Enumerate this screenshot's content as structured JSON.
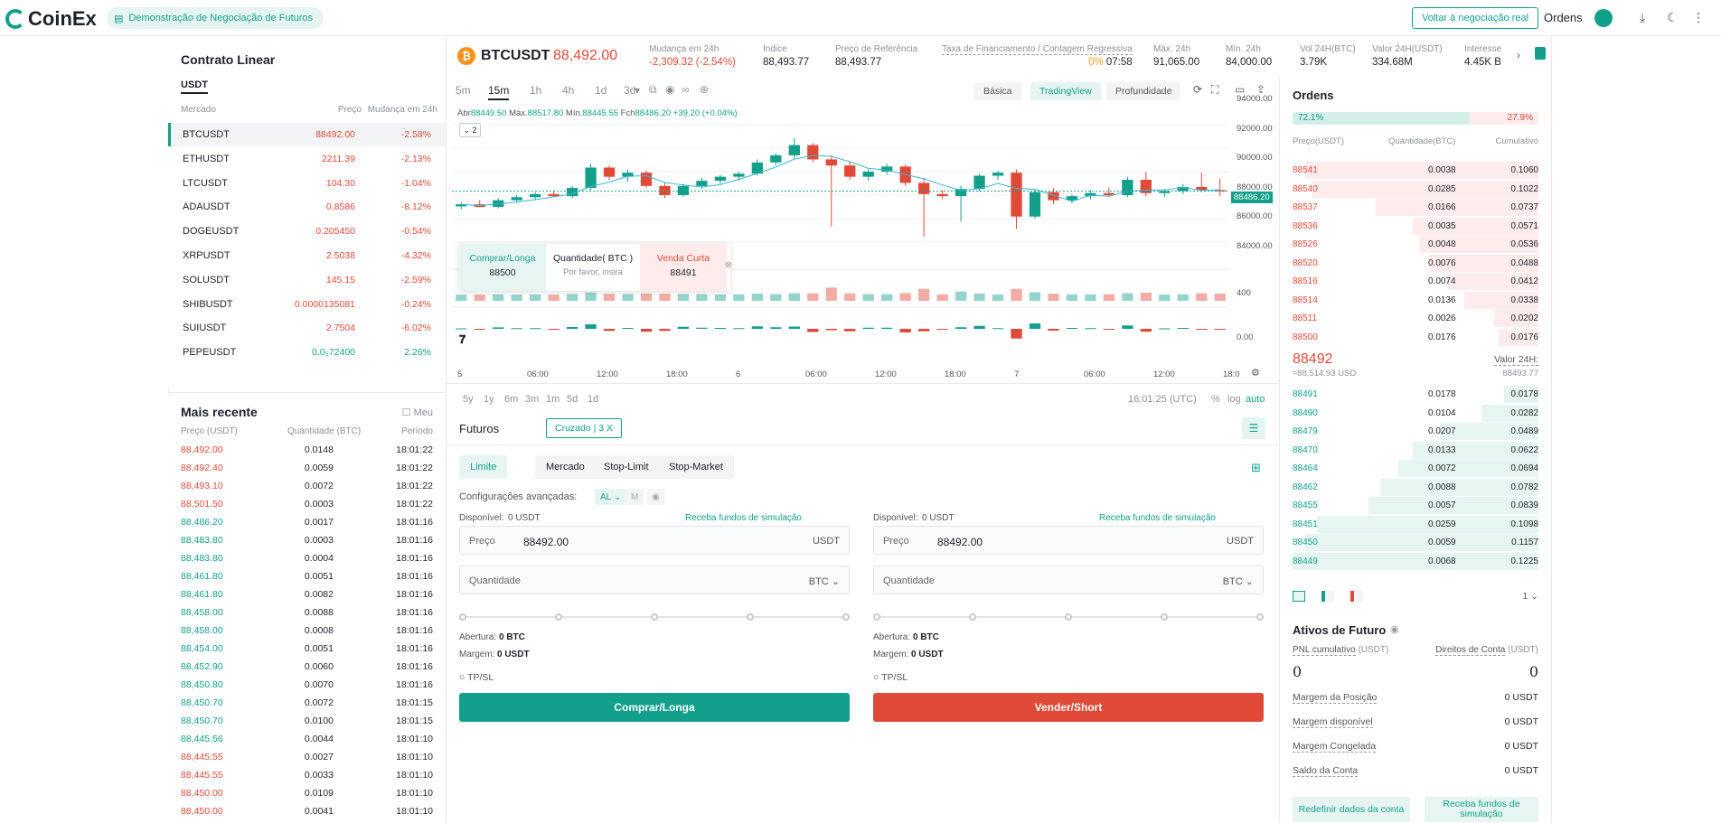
{
  "header": {
    "logo": "CoinEx",
    "demo_label": "Demonstração de Negociação de Futuros",
    "back_button": "Voltar à negociação real",
    "orders_link": "Ordens"
  },
  "markets": {
    "title": "Contrato Linear",
    "tab": "USDT",
    "col_market": "Mercado",
    "col_price": "Preço",
    "col_change": "Mudança em 24h",
    "rows": [
      {
        "symbol": "BTCUSDT",
        "price": "88492.00",
        "change": "-2.58%",
        "dir": "dn"
      },
      {
        "symbol": "ETHUSDT",
        "price": "2211.39",
        "change": "-2.13%",
        "dir": "dn"
      },
      {
        "symbol": "LTCUSDT",
        "price": "104.30",
        "change": "-1.04%",
        "dir": "dn"
      },
      {
        "symbol": "ADAUSDT",
        "price": "0.8586",
        "change": "-8.12%",
        "dir": "dn"
      },
      {
        "symbol": "DOGEUSDT",
        "price": "0.205450",
        "change": "-0.54%",
        "dir": "dn"
      },
      {
        "symbol": "XRPUSDT",
        "price": "2.5038",
        "change": "-4.32%",
        "dir": "dn"
      },
      {
        "symbol": "SOLUSDT",
        "price": "145.15",
        "change": "-2.59%",
        "dir": "dn"
      },
      {
        "symbol": "SHIBUSDT",
        "price": "0.0000135081",
        "change": "-0.24%",
        "dir": "dn"
      },
      {
        "symbol": "SUIUSDT",
        "price": "2.7504",
        "change": "-6.02%",
        "dir": "dn"
      },
      {
        "symbol": "PEPEUSDT",
        "price": "0.0₅72400",
        "change": "2.26%",
        "dir": "up"
      }
    ]
  },
  "trades": {
    "title": "Mais recente",
    "mine_label": "Meu",
    "col_price": "Preço (USDT)",
    "col_qty": "Quantidade (BTC)",
    "col_time": "Período",
    "rows": [
      {
        "p": "88,492.00",
        "q": "0.0148",
        "t": "18:01:22",
        "dir": "dn"
      },
      {
        "p": "88,492.40",
        "q": "0.0059",
        "t": "18:01:22",
        "dir": "dn"
      },
      {
        "p": "88,493.10",
        "q": "0.0072",
        "t": "18:01:22",
        "dir": "dn"
      },
      {
        "p": "88,501.50",
        "q": "0.0003",
        "t": "18:01:22",
        "dir": "dn"
      },
      {
        "p": "88,486.20",
        "q": "0.0017",
        "t": "18:01:16",
        "dir": "up"
      },
      {
        "p": "88,483.80",
        "q": "0.0003",
        "t": "18:01:16",
        "dir": "up"
      },
      {
        "p": "88,483.80",
        "q": "0.0004",
        "t": "18:01:16",
        "dir": "up"
      },
      {
        "p": "88,461.80",
        "q": "0.0051",
        "t": "18:01:16",
        "dir": "up"
      },
      {
        "p": "88,461.80",
        "q": "0.0082",
        "t": "18:01:16",
        "dir": "up"
      },
      {
        "p": "88,458.00",
        "q": "0.0088",
        "t": "18:01:16",
        "dir": "up"
      },
      {
        "p": "88,458.00",
        "q": "0.0008",
        "t": "18:01:16",
        "dir": "up"
      },
      {
        "p": "88,454.00",
        "q": "0.0051",
        "t": "18:01:16",
        "dir": "up"
      },
      {
        "p": "88,452.90",
        "q": "0.0060",
        "t": "18:01:16",
        "dir": "up"
      },
      {
        "p": "88,450.80",
        "q": "0.0070",
        "t": "18:01:16",
        "dir": "up"
      },
      {
        "p": "88,450.70",
        "q": "0.0072",
        "t": "18:01:15",
        "dir": "up"
      },
      {
        "p": "88,450.70",
        "q": "0.0100",
        "t": "18:01:15",
        "dir": "up"
      },
      {
        "p": "88,445.56",
        "q": "0.0044",
        "t": "18:01:10",
        "dir": "up"
      },
      {
        "p": "88,445.55",
        "q": "0.0027",
        "t": "18:01:10",
        "dir": "dn"
      },
      {
        "p": "88,445.55",
        "q": "0.0033",
        "t": "18:01:10",
        "dir": "dn"
      },
      {
        "p": "88,450.00",
        "q": "0.0109",
        "t": "18:01:10",
        "dir": "dn"
      },
      {
        "p": "88,450.00",
        "q": "0.0041",
        "t": "18:01:10",
        "dir": "dn"
      }
    ]
  },
  "ticker": {
    "symbol": "BTCUSDT",
    "last": "88,492.00",
    "items": [
      {
        "label": "Mudança em 24h",
        "value": "-2,309.32 (-2.54%)",
        "dir": "dn"
      },
      {
        "label": "Índice",
        "value": "88,493.77"
      },
      {
        "label": "Preço de Referência",
        "value": "88,493.77"
      },
      {
        "label": "Taxa de Financiamento / Contagem Regressiva",
        "value": "0%",
        "value2": "07:58"
      },
      {
        "label": "Máx. 24h",
        "value": "91,065.00"
      },
      {
        "label": "Mín. 24h",
        "value": "84,000.00"
      },
      {
        "label": "Vol 24H(BTC)",
        "value": "3.79K"
      },
      {
        "label": "Valor 24H(USDT)",
        "value": "334.68M"
      },
      {
        "label": "Interesse",
        "value": "4.45K B"
      }
    ]
  },
  "chart": {
    "timeframes": [
      "5m",
      "15m",
      "1h",
      "4h",
      "1d",
      "3d"
    ],
    "selected_tf": "15m",
    "views": [
      "Básica",
      "TradingView",
      "Profundidade"
    ],
    "selected_view": "TradingView",
    "ohlc": {
      "abr": "Abr",
      "abr_v": "88449.50",
      "max": "Máx.",
      "max_v": "88517.80",
      "min": "Mín.",
      "min_v": "88445.55",
      "fch": "Fch",
      "fch_v": "88486.20",
      "chg": "+39.20 (+0.04%)"
    },
    "indicator_count": "2",
    "price_ticks": [
      "94000.00",
      "92000.00",
      "90000.00",
      "88000.00",
      "86000.00",
      "84000.00"
    ],
    "last_price_tag": "88486.20",
    "volume_tick": "400",
    "macd_tick": "0.00",
    "time_ticks": [
      "5",
      "06:00",
      "12:00",
      "18:00",
      "6",
      "06:00",
      "12:00",
      "18:00",
      "7",
      "06:00",
      "12:00",
      "18:0"
    ],
    "ranges": [
      "5y",
      "1y",
      "6m",
      "3m",
      "1m",
      "5d",
      "1d"
    ],
    "clock": "16:01:25 (UTC)",
    "scale_opts": [
      "%",
      "log",
      "auto"
    ],
    "quick": {
      "buy": "Comprar/Longa",
      "buy_price": "88500",
      "qty": "Quantidade( BTC )",
      "qty_ph": "Por favor, insira",
      "sell": "Venda Curta",
      "sell_price": "88491"
    }
  },
  "chart_data": {
    "type": "candlestick",
    "ylim": [
      83500,
      95000
    ],
    "candles": [
      {
        "o": 87000,
        "h": 87400,
        "l": 86700,
        "c": 87200
      },
      {
        "o": 87200,
        "h": 87600,
        "l": 86900,
        "c": 86950
      },
      {
        "o": 86950,
        "h": 87800,
        "l": 86800,
        "c": 87600
      },
      {
        "o": 87600,
        "h": 88100,
        "l": 87400,
        "c": 87900
      },
      {
        "o": 87900,
        "h": 88400,
        "l": 87600,
        "c": 88200
      },
      {
        "o": 88200,
        "h": 88600,
        "l": 87900,
        "c": 88000
      },
      {
        "o": 88000,
        "h": 89000,
        "l": 87800,
        "c": 88800
      },
      {
        "o": 88800,
        "h": 91200,
        "l": 88600,
        "c": 90800
      },
      {
        "o": 90800,
        "h": 91000,
        "l": 89600,
        "c": 89900
      },
      {
        "o": 89900,
        "h": 90600,
        "l": 89400,
        "c": 90300
      },
      {
        "o": 90300,
        "h": 90500,
        "l": 88800,
        "c": 89000
      },
      {
        "o": 89000,
        "h": 89300,
        "l": 87800,
        "c": 88100
      },
      {
        "o": 88100,
        "h": 89200,
        "l": 87900,
        "c": 89000
      },
      {
        "o": 89000,
        "h": 89800,
        "l": 88700,
        "c": 89500
      },
      {
        "o": 89500,
        "h": 90100,
        "l": 89200,
        "c": 89900
      },
      {
        "o": 89900,
        "h": 90400,
        "l": 89500,
        "c": 90200
      },
      {
        "o": 90200,
        "h": 91600,
        "l": 90000,
        "c": 91300
      },
      {
        "o": 91300,
        "h": 92200,
        "l": 91000,
        "c": 92000
      },
      {
        "o": 92000,
        "h": 93700,
        "l": 91700,
        "c": 93000
      },
      {
        "o": 93000,
        "h": 93200,
        "l": 91300,
        "c": 91600
      },
      {
        "o": 91600,
        "h": 92000,
        "l": 85000,
        "c": 91000
      },
      {
        "o": 91000,
        "h": 91400,
        "l": 89600,
        "c": 89900
      },
      {
        "o": 89900,
        "h": 90600,
        "l": 89500,
        "c": 90400
      },
      {
        "o": 90400,
        "h": 91200,
        "l": 90100,
        "c": 90900
      },
      {
        "o": 90900,
        "h": 91100,
        "l": 89000,
        "c": 89300
      },
      {
        "o": 89300,
        "h": 89800,
        "l": 84000,
        "c": 88200
      },
      {
        "o": 88200,
        "h": 88600,
        "l": 87700,
        "c": 88000
      },
      {
        "o": 88000,
        "h": 89000,
        "l": 85500,
        "c": 88700
      },
      {
        "o": 88700,
        "h": 90200,
        "l": 88500,
        "c": 90000
      },
      {
        "o": 90000,
        "h": 90500,
        "l": 89600,
        "c": 90300
      },
      {
        "o": 90300,
        "h": 90600,
        "l": 84800,
        "c": 86000
      },
      {
        "o": 86000,
        "h": 88600,
        "l": 85800,
        "c": 88400
      },
      {
        "o": 88400,
        "h": 88800,
        "l": 87200,
        "c": 87600
      },
      {
        "o": 87600,
        "h": 88200,
        "l": 87300,
        "c": 88000
      },
      {
        "o": 88000,
        "h": 88600,
        "l": 87700,
        "c": 88300
      },
      {
        "o": 88300,
        "h": 88900,
        "l": 87900,
        "c": 88100
      },
      {
        "o": 88100,
        "h": 89900,
        "l": 87900,
        "c": 89600
      },
      {
        "o": 89600,
        "h": 90400,
        "l": 88000,
        "c": 88300
      },
      {
        "o": 88300,
        "h": 88700,
        "l": 87900,
        "c": 88500
      },
      {
        "o": 88500,
        "h": 89200,
        "l": 88200,
        "c": 88900
      },
      {
        "o": 88900,
        "h": 90300,
        "l": 88400,
        "c": 88600
      },
      {
        "o": 88600,
        "h": 89700,
        "l": 88000,
        "c": 88486
      }
    ]
  },
  "entry": {
    "title": "Futuros",
    "mode": "Cruzado | 3 X",
    "types": [
      "Limite",
      "Mercado",
      "Stop-Limit",
      "Stop-Market"
    ],
    "selected_type": "Limite",
    "advanced": "Configurações avançadas:",
    "adv_opts": [
      "AL",
      "M"
    ],
    "buy": {
      "avail": "Disponível:",
      "avail_v": "0 USDT",
      "funds": "Receba fundos de simulação",
      "price_l": "Preço",
      "price_v": "88492.00",
      "price_u": "USDT",
      "qty_l": "Quantidade",
      "qty_u": "BTC",
      "open": "Abertura:",
      "open_v": "0 BTC",
      "margin": "Margem:",
      "margin_v": "0 USDT",
      "tpsl": "TP/SL",
      "button": "Comprar/Longa"
    },
    "sell": {
      "avail": "Disponível:",
      "avail_v": "0 USDT",
      "funds": "Receba fundos de simulação",
      "price_l": "Preço",
      "price_v": "88492.00",
      "price_u": "USDT",
      "qty_l": "Quantidade",
      "qty_u": "BTC",
      "open": "Abertura:",
      "open_v": "0 BTC",
      "margin": "Margem:",
      "margin_v": "0 USDT",
      "tpsl": "TP/SL",
      "button": "Vender/Short"
    }
  },
  "book": {
    "title": "Ordens",
    "buy_pct": "72.1%",
    "sell_pct": "27.9%",
    "buy_ratio": 0.721,
    "col_price": "Preço(USDT)",
    "col_qty": "Quantidade(BTC)",
    "col_cum": "Cumulativo",
    "asks": [
      {
        "p": "88541",
        "q": "0.0038",
        "c": "0.1060",
        "d": 0.95
      },
      {
        "p": "88540",
        "q": "0.0285",
        "c": "0.1022",
        "d": 0.92
      },
      {
        "p": "88537",
        "q": "0.0166",
        "c": "0.0737",
        "d": 0.66
      },
      {
        "p": "88536",
        "q": "0.0035",
        "c": "0.0571",
        "d": 0.51
      },
      {
        "p": "88526",
        "q": "0.0048",
        "c": "0.0536",
        "d": 0.48
      },
      {
        "p": "88520",
        "q": "0.0076",
        "c": "0.0488",
        "d": 0.44
      },
      {
        "p": "88516",
        "q": "0.0074",
        "c": "0.0412",
        "d": 0.37
      },
      {
        "p": "88514",
        "q": "0.0136",
        "c": "0.0338",
        "d": 0.3
      },
      {
        "p": "88511",
        "q": "0.0026",
        "c": "0.0202",
        "d": 0.18
      },
      {
        "p": "88500",
        "q": "0.0176",
        "c": "0.0176",
        "d": 0.16
      }
    ],
    "mid": "88492",
    "mid_usd": "≈88,514.93 USD",
    "mid_label": "Valor 24H:",
    "mid_value": "88493.77",
    "bids": [
      {
        "p": "88491",
        "q": "0.0178",
        "c": "0.0178",
        "d": 0.14
      },
      {
        "p": "88490",
        "q": "0.0104",
        "c": "0.0282",
        "d": 0.23
      },
      {
        "p": "88479",
        "q": "0.0207",
        "c": "0.0489",
        "d": 0.4
      },
      {
        "p": "88470",
        "q": "0.0133",
        "c": "0.0622",
        "d": 0.51
      },
      {
        "p": "88464",
        "q": "0.0072",
        "c": "0.0694",
        "d": 0.57
      },
      {
        "p": "88462",
        "q": "0.0088",
        "c": "0.0782",
        "d": 0.64
      },
      {
        "p": "88455",
        "q": "0.0057",
        "c": "0.0839",
        "d": 0.69
      },
      {
        "p": "88451",
        "q": "0.0259",
        "c": "0.1098",
        "d": 0.9
      },
      {
        "p": "88450",
        "q": "0.0059",
        "c": "0.1157",
        "d": 0.95
      },
      {
        "p": "88449",
        "q": "0.0068",
        "c": "0.1225",
        "d": 1.0
      }
    ],
    "precision": "1"
  },
  "assets": {
    "title": "Ativos de Futuro",
    "pnl_label": "PNL cumulativo",
    "pnl_unit": "(USDT)",
    "pnl_v": "0",
    "eq_label": "Direitos de Conta",
    "eq_unit": "(USDT)",
    "eq_v": "0",
    "rows": [
      {
        "k": "Margem da Posição",
        "v": "0 USDT"
      },
      {
        "k": "Margem disponível",
        "v": "0 USDT"
      },
      {
        "k": "Margem Congelada",
        "v": "0 USDT"
      },
      {
        "k": "Saldo da Conta",
        "v": "0 USDT"
      }
    ],
    "reset": "Redefinir dados da conta",
    "funds": "Receba fundos de simulação"
  },
  "colors": {
    "up": "#12a08a",
    "down": "#e04a38",
    "accent": "#12a08a"
  }
}
